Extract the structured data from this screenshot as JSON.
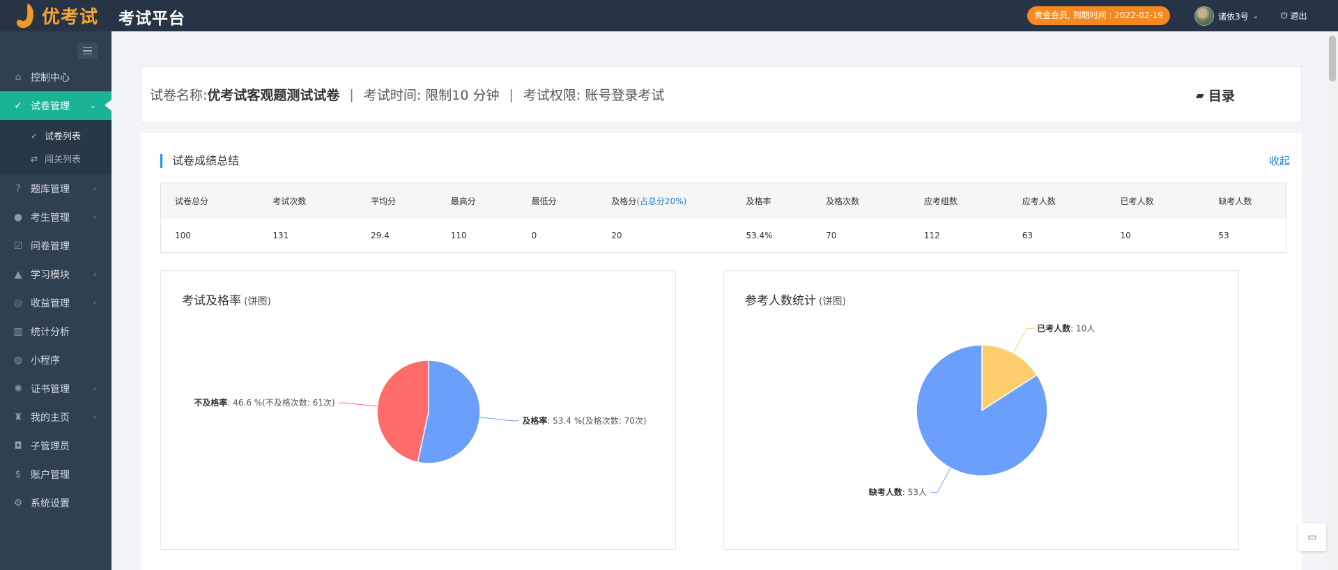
{
  "header": {
    "logo_text": "优考试",
    "app_title": "考试平台",
    "member_badge": "黄金会员, 到期时间 : 2022-02-19",
    "username": "诸依3号",
    "logout": "退出"
  },
  "sidebar": {
    "items": [
      {
        "label": "控制中心",
        "icon": "home-icon",
        "glyph": "⌂",
        "arrow": false
      },
      {
        "label": "试卷管理",
        "icon": "check-circle-icon",
        "glyph": "✓",
        "arrow": true,
        "active": true
      },
      {
        "label": "题库管理",
        "icon": "question-circle-icon",
        "glyph": "?",
        "arrow": true
      },
      {
        "label": "考生管理",
        "icon": "user-icon",
        "glyph": "●",
        "arrow": true
      },
      {
        "label": "问卷管理",
        "icon": "checkbox-icon",
        "glyph": "☑",
        "arrow": false
      },
      {
        "label": "学习模块",
        "icon": "graduation-cap-icon",
        "glyph": "▲",
        "arrow": true
      },
      {
        "label": "收益管理",
        "icon": "money-icon",
        "glyph": "◎",
        "arrow": true
      },
      {
        "label": "统计分析",
        "icon": "bar-chart-icon",
        "glyph": "▥",
        "arrow": false
      },
      {
        "label": "小程序",
        "icon": "wechat-icon",
        "glyph": "◍",
        "arrow": false
      },
      {
        "label": "证书管理",
        "icon": "certificate-icon",
        "glyph": "✺",
        "arrow": true
      },
      {
        "label": "我的主页",
        "icon": "home-page-icon",
        "glyph": "♜",
        "arrow": true
      },
      {
        "label": "子管理员",
        "icon": "user-lock-icon",
        "glyph": "◘",
        "arrow": false
      },
      {
        "label": "账户管理",
        "icon": "dollar-icon",
        "glyph": "$",
        "arrow": false
      },
      {
        "label": "系统设置",
        "icon": "gear-icon",
        "glyph": "⚙",
        "arrow": false
      }
    ],
    "sub_items": [
      {
        "label": "试卷列表",
        "icon": "check-circle-icon",
        "glyph": "✓",
        "active": true
      },
      {
        "label": "闯关列表",
        "icon": "shuffle-icon",
        "glyph": "⇄"
      }
    ]
  },
  "info": {
    "name_label": "试卷名称: ",
    "name_value": "优考试客观题测试试卷",
    "time_text": "考试时间: 限制10 分钟",
    "perm_text": "考试权限: 账号登录考试",
    "catalog": "目录"
  },
  "summary": {
    "title": "试卷成绩总结",
    "collapse": "收起",
    "headers": [
      "试卷总分",
      "考试次数",
      "平均分",
      "最高分",
      "最低分",
      "及格分",
      "及格率",
      "及格次数",
      "应考组数",
      "应考人数",
      "已考人数",
      "缺考人数"
    ],
    "pass_hint": "(占总分20%)",
    "values": [
      "100",
      "131",
      "29.4",
      "110",
      "0",
      "20",
      "53.4%",
      "70",
      "112",
      "63",
      "10",
      "53"
    ]
  },
  "chart_data": [
    {
      "type": "pie",
      "title": "考试及格率",
      "subtitle": "(饼图)",
      "slices": [
        {
          "name": "及格率",
          "value": 53.4,
          "label": ": 53.4 %(及格次数: 70次)",
          "color": "#6a9ffb"
        },
        {
          "name": "不及格率",
          "value": 46.6,
          "label": ": 46.6 %(不及格次数: 61次)",
          "color": "#fe6b6b"
        }
      ]
    },
    {
      "type": "pie",
      "title": "参考人数统计",
      "subtitle": "(饼图)",
      "slices": [
        {
          "name": "已考人数",
          "value": 10,
          "label": ": 10人",
          "color": "#fecd6e"
        },
        {
          "name": "缺考人数",
          "value": 53,
          "label": ": 53人",
          "color": "#6a9ffb"
        }
      ]
    }
  ]
}
